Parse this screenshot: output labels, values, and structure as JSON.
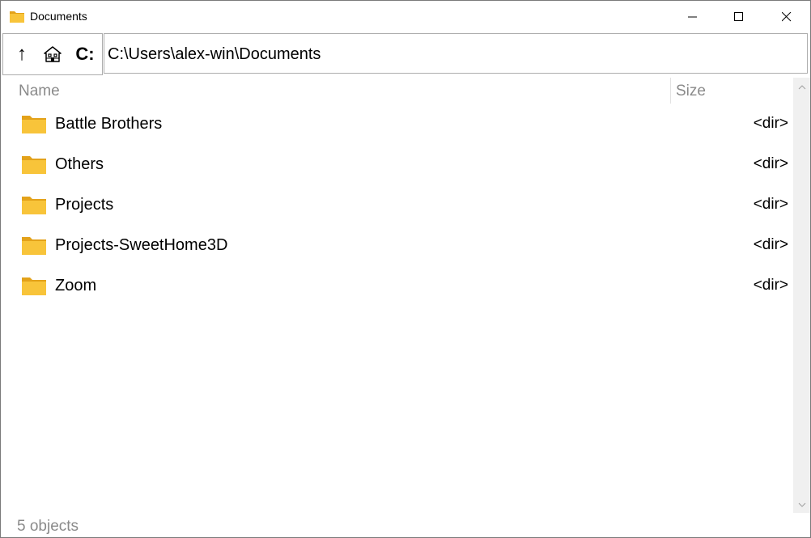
{
  "window": {
    "title": "Documents"
  },
  "toolbar": {
    "up_label": "↑",
    "home_label": "home",
    "drive_label": "C:",
    "path_value": "C:\\Users\\alex-win\\Documents"
  },
  "columns": {
    "name": "Name",
    "size": "Size"
  },
  "files": [
    {
      "name": "Battle Brothers",
      "size": "<dir>",
      "icon": "folder-icon"
    },
    {
      "name": "Others",
      "size": "<dir>",
      "icon": "folder-icon"
    },
    {
      "name": "Projects",
      "size": "<dir>",
      "icon": "folder-icon"
    },
    {
      "name": "Projects-SweetHome3D",
      "size": "<dir>",
      "icon": "folder-icon"
    },
    {
      "name": "Zoom",
      "size": "<dir>",
      "icon": "folder-icon"
    }
  ],
  "status": {
    "text": "5 objects"
  },
  "colors": {
    "folder": "#f8c43a",
    "folder_dark": "#e3a21a",
    "muted_text": "#8a8a8a"
  }
}
